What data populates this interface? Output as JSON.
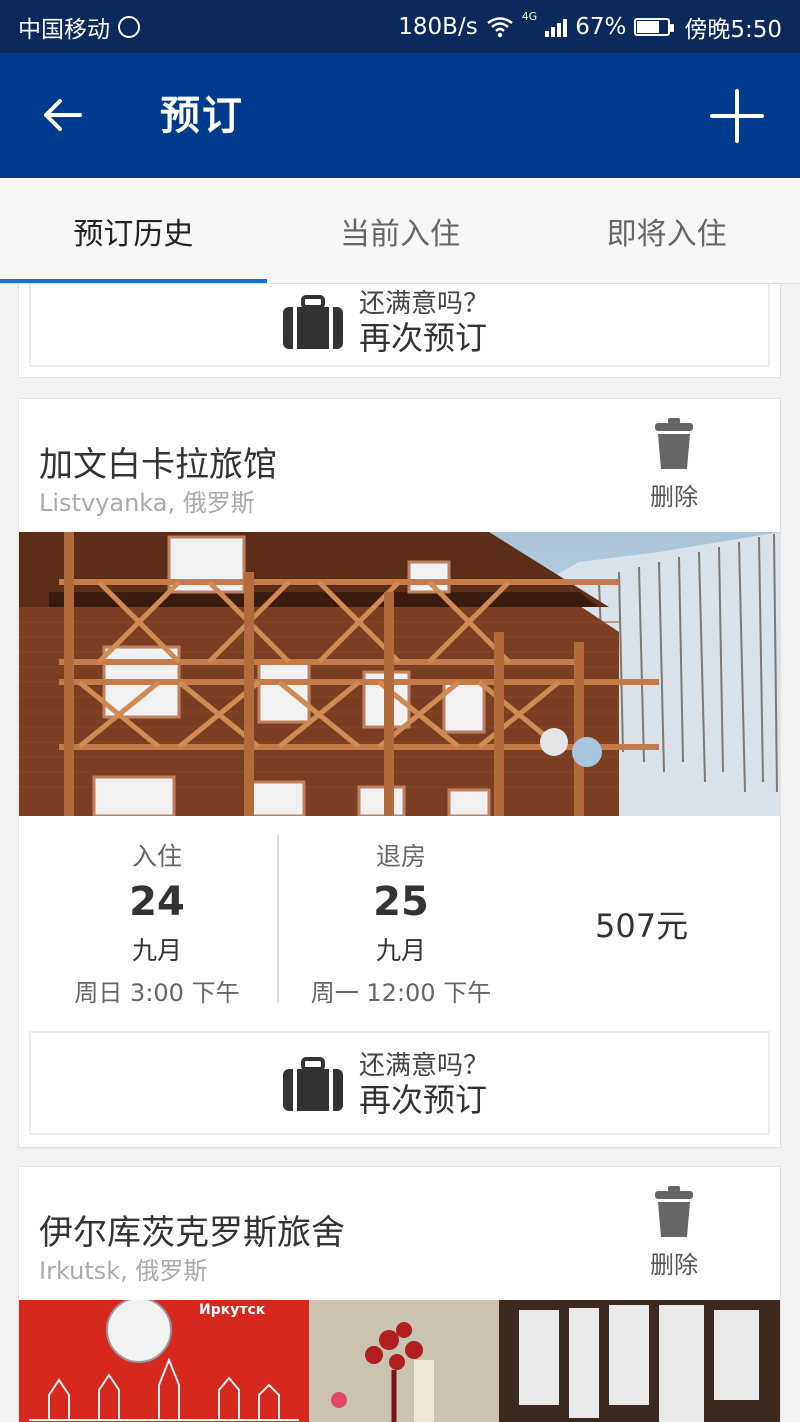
{
  "status_bar": {
    "carrier": "中国移动",
    "speed": "180B/s",
    "network": "4G",
    "battery": "67%",
    "battery_level": 0.67,
    "time": "傍晚5:50"
  },
  "app_bar": {
    "title": "预订"
  },
  "tabs": [
    {
      "label": "预订历史",
      "active": true
    },
    {
      "label": "当前入住",
      "active": false
    },
    {
      "label": "即将入住",
      "active": false
    }
  ],
  "rebook": {
    "question": "还满意吗？",
    "action": "再次预订"
  },
  "bookings": [
    {
      "name": "加文白卡拉旅馆",
      "location": "Listvyanka, 俄罗斯",
      "delete_label": "删除",
      "checkin": {
        "label": "入住",
        "day": "24",
        "month": "九月",
        "time": "周日 3:00 下午"
      },
      "checkout": {
        "label": "退房",
        "day": "25",
        "month": "九月",
        "time": "周一 12:00 下午"
      },
      "price": "507元"
    },
    {
      "name": "伊尔库茨克罗斯旅舍",
      "location": "Irkutsk, 俄罗斯",
      "delete_label": "删除",
      "photo_sign": "Иркутск"
    }
  ],
  "colors": {
    "status_bar": "#0b2a5c",
    "app_bar": "#003a8c",
    "tab_indicator": "#1f6fd1"
  },
  "icons": [
    "back-arrow-icon",
    "plus-icon",
    "suitcase-icon",
    "trash-icon",
    "wifi-icon",
    "signal-icon",
    "battery-icon"
  ]
}
